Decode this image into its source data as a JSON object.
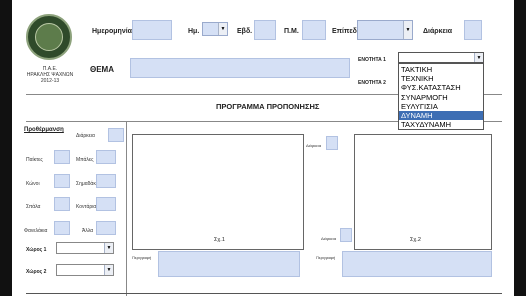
{
  "header": {
    "date_label": "Ημερομηνία",
    "day_label": "Ημ.",
    "week_label": "Εβδ.",
    "pm_label": "Π.Μ.",
    "level_label": "Επίπεδο",
    "duration_label": "Διάρκεια",
    "unit1_label": "ΕΝΟΤΗΤΑ 1",
    "unit2_label": "ΕΝΟΤΗΤΑ 2",
    "theme_label": "ΘΕΜΑ"
  },
  "org": {
    "line1": "Π.Α.Ε.",
    "line2": "ΗΡΑΚΛΗΣ ΨΑΧΝΩΝ",
    "line3": "2012-13"
  },
  "unit1_dropdown": {
    "selected": "",
    "options": [
      "ΤΑΚΤΙΚΗ",
      "ΤΕΧΝΙΚΗ",
      "ΦΥΣ.ΚΑΤΑΣΤΑΣΗ",
      "ΣΥΝΑΡΜΟΓΗ",
      "ΕΥΛΥΓΙΣΙΑ",
      "ΔΥΝΑΜΗ",
      "ΤΑΧΥΔΥΝΑΜΗ"
    ],
    "highlighted": "ΔΥΝΑΜΗ"
  },
  "section_title": "ΠΡΟΓΡΑΜΜΑ ΠΡΟΠΟΝΗΣΗΣ",
  "warmup": {
    "title": "Προθέρμανση",
    "duration_label": "Διάρκεια",
    "players_label": "Παίκτες",
    "balls_label": "Μπάλες",
    "cones_label": "Κώνοι",
    "poles_label": "Σημαδάκια",
    "hurdles_label": "Σπάλα",
    "jerseys_label": "Κοντάρια",
    "bibs_label": "Φανελάκια",
    "other_label": "Άλλα",
    "space1_label": "Χώρος 1",
    "space2_label": "Χώρος 2"
  },
  "drill1": {
    "caption": "Σχ.1",
    "description_label": "Περιγραφή"
  },
  "drill2": {
    "duration_label": "Διάρκεια",
    "duration_label_lower": "Διάρκεια",
    "caption": "Σχ.2",
    "description_label": "Περιγραφή"
  }
}
